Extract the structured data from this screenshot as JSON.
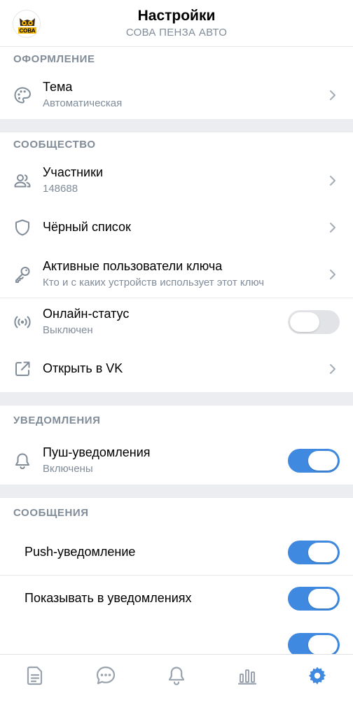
{
  "header": {
    "title": "Настройки",
    "subtitle": "СОВА ПЕНЗА АВТО",
    "logo_text": "СОВА"
  },
  "sections": {
    "appearance": {
      "title": "ОФОРМЛЕНИЕ",
      "theme": {
        "label": "Тема",
        "value": "Автоматическая",
        "icon": "palette-icon"
      }
    },
    "community": {
      "title": "СООБЩЕСТВО",
      "members": {
        "label": "Участники",
        "value": "148688",
        "icon": "users-icon"
      },
      "blacklist": {
        "label": "Чёрный список",
        "icon": "shield-icon"
      },
      "active_keys": {
        "label": "Активные пользователи ключа",
        "value": "Кто и с каких устройств использует этот ключ",
        "icon": "key-icon"
      },
      "online_status": {
        "label": "Онлайн-статус",
        "value": "Выключен",
        "enabled": false,
        "icon": "broadcast-icon"
      },
      "open_vk": {
        "label": "Открыть в VK",
        "icon": "external-link-icon"
      }
    },
    "notifications": {
      "title": "УВЕДОМЛЕНИЯ",
      "push": {
        "label": "Пуш-уведомления",
        "value": "Включены",
        "enabled": true,
        "icon": "bell-icon"
      }
    },
    "messages": {
      "title": "СООБЩЕНИЯ",
      "push_notification": {
        "label": "Push-уведомление",
        "enabled": true
      },
      "show_in_notifications": {
        "label": "Показывать в уведомлениях",
        "enabled": true
      },
      "third": {
        "enabled": true
      }
    }
  },
  "tabbar": {
    "items": [
      {
        "icon": "document-icon",
        "active": false
      },
      {
        "icon": "chat-icon",
        "active": false
      },
      {
        "icon": "bell-icon",
        "active": false
      },
      {
        "icon": "stats-icon",
        "active": false
      },
      {
        "icon": "settings-icon",
        "active": true
      }
    ]
  },
  "colors": {
    "accent": "#3f8ae0",
    "secondary_text": "#818c99",
    "separator": "#ebedf0",
    "toggle_off": "#e1e3e6"
  }
}
